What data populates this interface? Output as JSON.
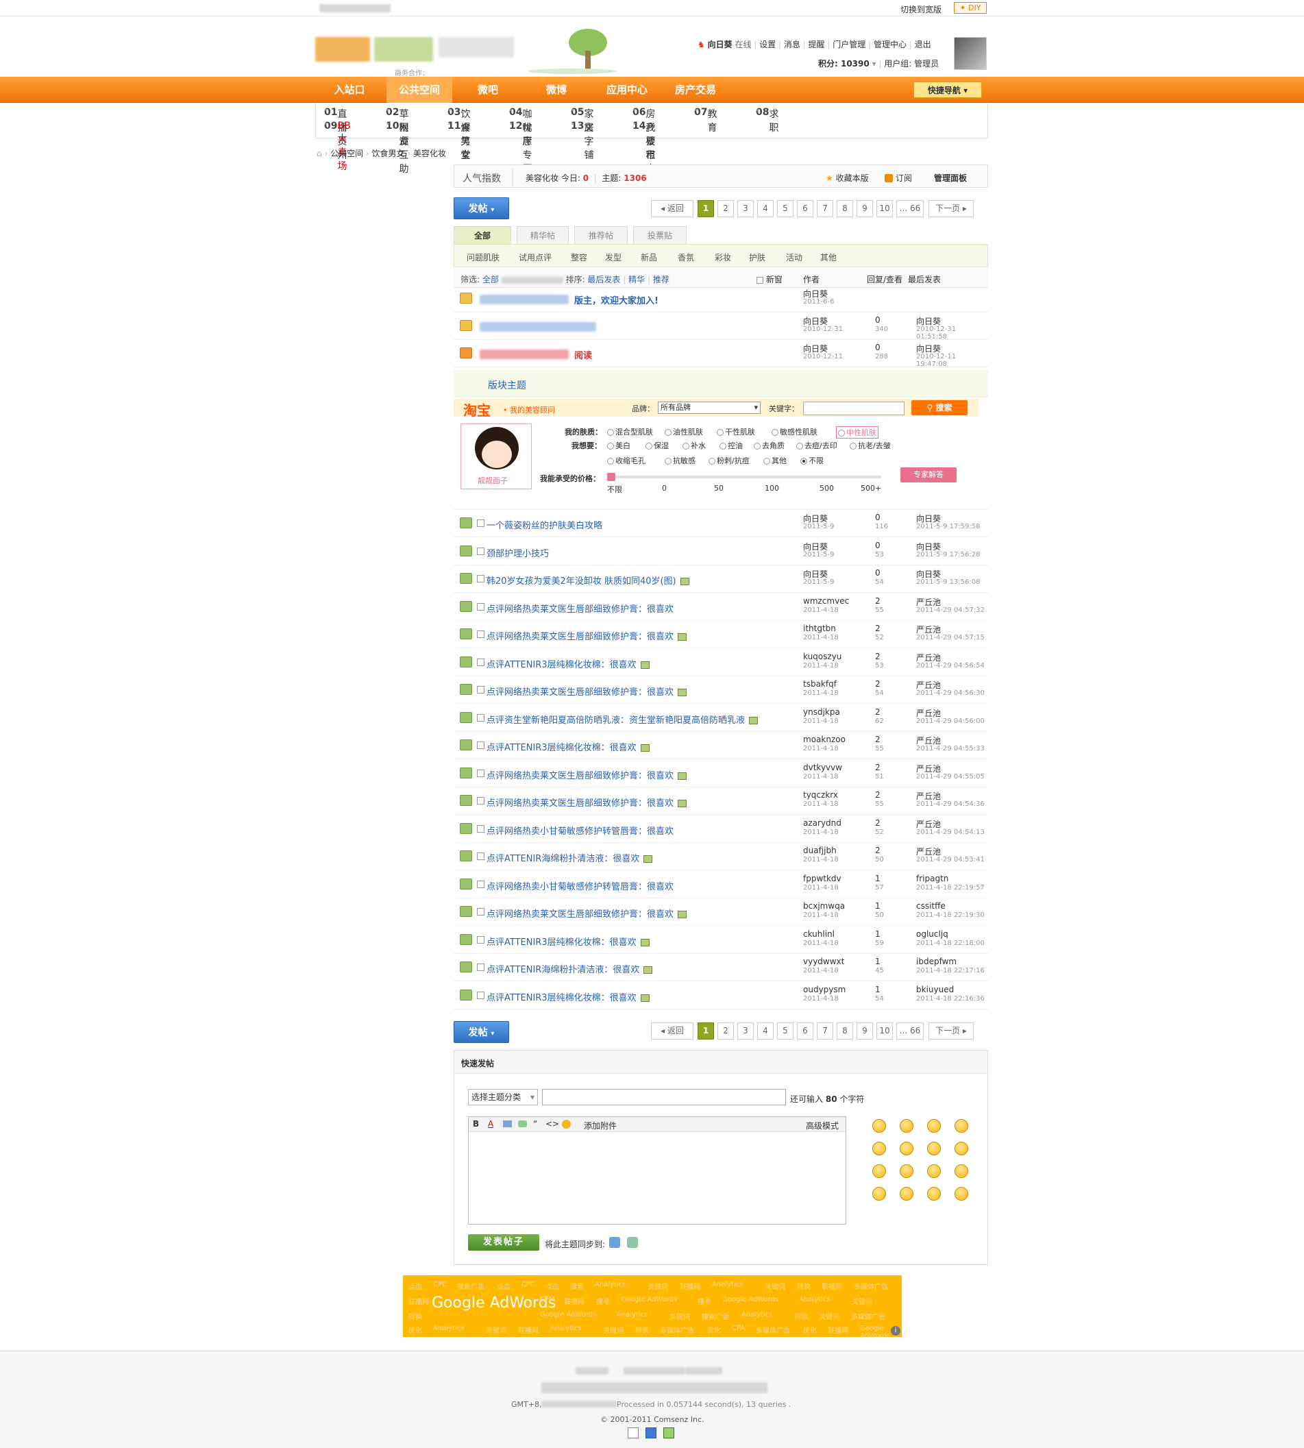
{
  "topbar": {
    "switch_label": "切换到宽版",
    "diy_label": "DIY"
  },
  "header": {
    "user_name": "向日葵",
    "online": "在线",
    "links": [
      "设置",
      "消息",
      "提醒",
      "门户管理",
      "管理中心",
      "退出"
    ],
    "points_label": "积分: 10390",
    "group_label": "用户组: 管理员",
    "biz_label": "商务合作："
  },
  "nav": {
    "items": [
      "入站口",
      "公共空间",
      "微吧",
      "微博",
      "应用中心",
      "房产交易"
    ],
    "quick_label": "快捷导航"
  },
  "subnav": [
    {
      "num": "01",
      "label": "直播贵州"
    },
    {
      "num": "02",
      "label": "草根谭"
    },
    {
      "num": "03",
      "label": "饮食男女"
    },
    {
      "num": "04",
      "label": "咖啡厅"
    },
    {
      "num": "05",
      "label": "家居"
    },
    {
      "num": "06",
      "label": "房产楼市"
    },
    {
      "num": "07",
      "label": "教育"
    },
    {
      "num": "08",
      "label": "求职"
    },
    {
      "num": "09",
      "label": "BB大卖场"
    },
    {
      "num": "10",
      "label": "网友互助"
    },
    {
      "num": "11",
      "label": "爆笑堂"
    },
    {
      "num": "12",
      "label": "优惠专区"
    },
    {
      "num": "13",
      "label": "文字铺子"
    },
    {
      "num": "14",
      "label": "我要租房"
    }
  ],
  "breadcrumb": [
    "公共空间",
    "饮食男女",
    "美容化妆"
  ],
  "forum": {
    "popularity": "人气指数",
    "name": "美容化妆",
    "today_label": "今日:",
    "today": "0",
    "topics_label": "主题:",
    "topics": "1306",
    "fav": "收藏本版",
    "rss": "订阅",
    "admin": "管理面板"
  },
  "post_button": "发帖",
  "pager": {
    "prev": "返回",
    "pages": [
      "1",
      "2",
      "3",
      "4",
      "5",
      "6",
      "7",
      "8",
      "9",
      "10",
      "... 66"
    ],
    "next": "下一页"
  },
  "tabs": [
    "全部",
    "精华帖",
    "推荐帖",
    "投票贴"
  ],
  "categories": [
    "问题肌肤",
    "试用点评",
    "整容",
    "发型",
    "新品",
    "香氛",
    "彩妆",
    "护肤",
    "活动",
    "其他"
  ],
  "filter": {
    "label": "筛选:",
    "all": "全部",
    "sort_label": "排序:",
    "last_post": "最后发表",
    "digest": "精华",
    "recommend": "推荐",
    "new_window": "新窗",
    "author": "作者",
    "reply_view": "回复/查看",
    "last": "最后发表"
  },
  "sticky": [
    {
      "title": "版主，欢迎大家加入!",
      "author": "向日葵",
      "date": "2011-6-6",
      "replies": "",
      "views": "",
      "last_user": "",
      "last_date": ""
    },
    {
      "title": "",
      "author": "向日葵",
      "date": "2010-12-31",
      "replies": "0",
      "views": "340",
      "last_user": "向日葵",
      "last_date": "2010-12-31 01:51:58"
    },
    {
      "title": "阅读",
      "author": "向日葵",
      "date": "2010-12-11",
      "replies": "0",
      "views": "288",
      "last_user": "向日葵",
      "last_date": "2010-12-11 19:47:08"
    }
  ],
  "section_title": "版块主题",
  "taobao": {
    "logo": "淘宝",
    "sub": "我的美容顾问",
    "brand_label": "品牌：",
    "brand_value": "所有品牌",
    "kw_label": "关键字：",
    "search_btn": "搜索",
    "skin_label": "我的肤质：",
    "skin_opts": [
      "混合型肌肤",
      "油性肌肤",
      "干性肌肤",
      "敏感性肌肤",
      "中性肌肤"
    ],
    "want_label": "我想要：",
    "want_opts": [
      "美白",
      "保湿",
      "补水",
      "控油",
      "去角质",
      "去痘/去印",
      "抗老/去皱",
      "收缩毛孔",
      "抗敏感",
      "粉刺/抗痘",
      "其他",
      "不限"
    ],
    "price_label": "我能承受的价格：",
    "price_ticks": [
      "不限",
      "0",
      "50",
      "100",
      "500",
      "500+"
    ],
    "expert_btn": "专家解答",
    "avatar_name": "靓靓面子"
  },
  "threads": [
    {
      "title": "一个薇姿粉丝的护肤美白攻略",
      "att": false,
      "author": "向日葵",
      "date": "2011-5-9",
      "replies": "0",
      "views": "116",
      "last_user": "向日葵",
      "last_date": "2011-5-9 17:59:58"
    },
    {
      "title": "颈部护理小技巧",
      "att": false,
      "author": "向日葵",
      "date": "2011-5-9",
      "replies": "0",
      "views": "53",
      "last_user": "向日葵",
      "last_date": "2011-5-9 17:56:28"
    },
    {
      "title": "韩20岁女孩为爱美2年没卸妆 肤质如同40岁(图)",
      "att": true,
      "author": "向日葵",
      "date": "2011-5-9",
      "replies": "0",
      "views": "54",
      "last_user": "向日葵",
      "last_date": "2011-5-9 13:56:08"
    },
    {
      "title": "点评网络热卖莱文医生唇部细致修护膏：很喜欢",
      "att": false,
      "author": "wmzcmvec",
      "date": "2011-4-18",
      "replies": "2",
      "views": "55",
      "last_user": "严丘池",
      "last_date": "2011-4-29 04:57:32"
    },
    {
      "title": "点评网络热卖莱文医生唇部细致修护膏：很喜欢",
      "att": true,
      "author": "ithtgtbn",
      "date": "2011-4-18",
      "replies": "2",
      "views": "52",
      "last_user": "严丘池",
      "last_date": "2011-4-29 04:57:15"
    },
    {
      "title": "点评ATTENIR3层纯棉化妆棉：很喜欢",
      "att": true,
      "author": "kuqoszyu",
      "date": "2011-4-18",
      "replies": "2",
      "views": "53",
      "last_user": "严丘池",
      "last_date": "2011-4-29 04:56:54"
    },
    {
      "title": "点评网络热卖莱文医生唇部细致修护膏：很喜欢",
      "att": true,
      "author": "tsbakfqf",
      "date": "2011-4-18",
      "replies": "2",
      "views": "54",
      "last_user": "严丘池",
      "last_date": "2011-4-29 04:56:30"
    },
    {
      "title": "点评资生堂新艳阳夏高倍防晒乳液：资生堂新艳阳夏高倍防晒乳液",
      "att": true,
      "author": "ynsdjkpa",
      "date": "2011-4-18",
      "replies": "2",
      "views": "62",
      "last_user": "严丘池",
      "last_date": "2011-4-29 04:56:00"
    },
    {
      "title": "点评ATTENIR3层纯棉化妆棉：很喜欢",
      "att": true,
      "author": "moaknzoo",
      "date": "2011-4-18",
      "replies": "2",
      "views": "55",
      "last_user": "严丘池",
      "last_date": "2011-4-29 04:55:33"
    },
    {
      "title": "点评网络热卖莱文医生唇部细致修护膏：很喜欢",
      "att": true,
      "author": "dvtkyvvw",
      "date": "2011-4-18",
      "replies": "2",
      "views": "51",
      "last_user": "严丘池",
      "last_date": "2011-4-29 04:55:05"
    },
    {
      "title": "点评网络热卖莱文医生唇部细致修护膏：很喜欢",
      "att": true,
      "author": "tyqczkrx",
      "date": "2011-4-18",
      "replies": "2",
      "views": "55",
      "last_user": "严丘池",
      "last_date": "2011-4-29 04:54:36"
    },
    {
      "title": "点评网络热卖小甘菊敏感修护转管唇膏：很喜欢",
      "att": false,
      "author": "azarydnd",
      "date": "2011-4-18",
      "replies": "2",
      "views": "52",
      "last_user": "严丘池",
      "last_date": "2011-4-29 04:54:13"
    },
    {
      "title": "点评ATTENIR海绵粉扑清洁液：很喜欢",
      "att": true,
      "author": "duafjjbh",
      "date": "2011-4-18",
      "replies": "2",
      "views": "50",
      "last_user": "严丘池",
      "last_date": "2011-4-29 04:53:41"
    },
    {
      "title": "点评网络热卖小甘菊敏感修护转管唇膏：很喜欢",
      "att": false,
      "author": "fppwtkdv",
      "date": "2011-4-18",
      "replies": "1",
      "views": "57",
      "last_user": "fripagtn",
      "last_date": "2011-4-18 22:19:57"
    },
    {
      "title": "点评网络热卖莱文医生唇部细致修护膏：很喜欢",
      "att": true,
      "author": "bcxjmwqa",
      "date": "2011-4-18",
      "replies": "1",
      "views": "50",
      "last_user": "cssitffe",
      "last_date": "2011-4-18 22:19:30"
    },
    {
      "title": "点评ATTENIR3层纯棉化妆棉：很喜欢",
      "att": true,
      "author": "ckuhlinl",
      "date": "2011-4-18",
      "replies": "1",
      "views": "59",
      "last_user": "oglucljq",
      "last_date": "2011-4-18 22:18:00"
    },
    {
      "title": "点评ATTENIR海绵粉扑清洁液：很喜欢",
      "att": true,
      "author": "vyydwwxt",
      "date": "2011-4-18",
      "replies": "1",
      "views": "45",
      "last_user": "ibdepfwm",
      "last_date": "2011-4-18 22:17:16"
    },
    {
      "title": "点评ATTENIR3层纯棉化妆棉：很喜欢",
      "att": true,
      "author": "oudypysm",
      "date": "2011-4-18",
      "replies": "1",
      "views": "54",
      "last_user": "bkiuyued",
      "last_date": "2011-4-18 22:16:36"
    }
  ],
  "fastpost": {
    "title": "快速发帖",
    "select_label": "选择主题分类",
    "remain_prefix": "还可输入",
    "remain_count": "80",
    "remain_suffix": "个字符",
    "attach": "添加附件",
    "advanced": "高级模式",
    "submit": "发表帖子",
    "sync_label": "将此主题同步到:"
  },
  "ads": {
    "brand": "Google AdWords",
    "words": [
      "点击",
      "CPC",
      "搜索广告",
      "点击",
      "CPC",
      "点击",
      "搜索",
      "Analytics",
      "关键词",
      "联播网",
      "Analytics",
      "关键词",
      "转换",
      "联播网",
      "多媒体广告",
      "联播网",
      "CPM",
      "联播网",
      "搜寻",
      "Google AdWords",
      "搜寻",
      "Google AdWords",
      "Analytics",
      "关键词",
      "转换",
      "Google AdWords",
      "Analytics",
      "关键词",
      "搜索广告",
      "Analytics",
      "转换",
      "关键词",
      "多媒体广告",
      "优化",
      "Analytics",
      "关键词",
      "联播网",
      "Analytics",
      "关键词",
      "转换",
      "多媒体广告",
      "优化",
      "CPA",
      "多媒体广告",
      "优化",
      "联播网",
      "Google AdWords"
    ]
  },
  "footer": {
    "gmt": "GMT+8,",
    "processed": "Processed in 0.057144 second(s), 13 queries .",
    "copyright": "© 2001-2011 Comsenz Inc."
  }
}
